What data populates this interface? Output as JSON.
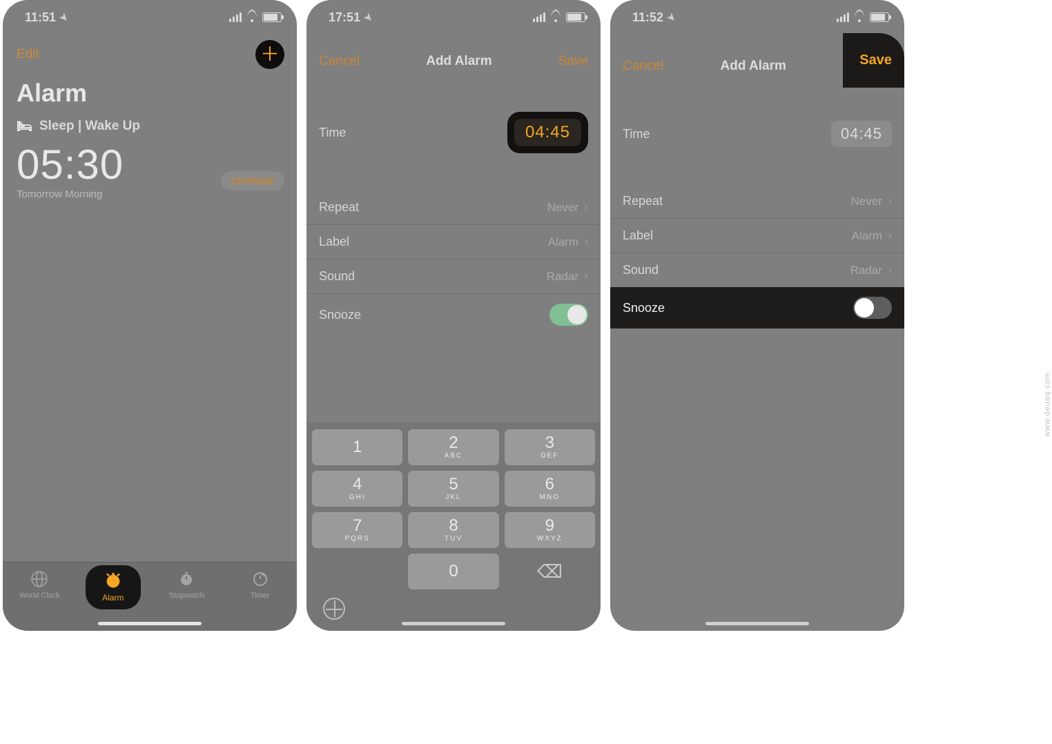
{
  "watermark": "www.deuaq.com",
  "screen1": {
    "status_time": "11:51",
    "edit": "Edit",
    "title": "Alarm",
    "sleep_label": "Sleep | Wake Up",
    "alarm_time": "05:30",
    "subtext": "Tomorrow Morning",
    "change": "CHANGE",
    "tabs": {
      "world_clock": "World Clock",
      "alarm": "Alarm",
      "stopwatch": "Stopwatch",
      "timer": "Timer"
    }
  },
  "screen2": {
    "status_time": "17:51",
    "cancel": "Cancel",
    "title": "Add Alarm",
    "save": "Save",
    "time_label": "Time",
    "time_value": "04:45",
    "repeat_label": "Repeat",
    "repeat_value": "Never",
    "label_label": "Label",
    "label_value": "Alarm",
    "sound_label": "Sound",
    "sound_value": "Radar",
    "snooze_label": "Snooze",
    "snooze_on": true,
    "keypad": {
      "1": {
        "num": "1",
        "letters": ""
      },
      "2": {
        "num": "2",
        "letters": "ABC"
      },
      "3": {
        "num": "3",
        "letters": "DEF"
      },
      "4": {
        "num": "4",
        "letters": "GHI"
      },
      "5": {
        "num": "5",
        "letters": "JKL"
      },
      "6": {
        "num": "6",
        "letters": "MNO"
      },
      "7": {
        "num": "7",
        "letters": "PQRS"
      },
      "8": {
        "num": "8",
        "letters": "TUV"
      },
      "9": {
        "num": "9",
        "letters": "WXYZ"
      },
      "0": {
        "num": "0",
        "letters": ""
      }
    }
  },
  "screen3": {
    "status_time": "11:52",
    "cancel": "Cancel",
    "title": "Add Alarm",
    "save": "Save",
    "time_label": "Time",
    "time_value": "04:45",
    "repeat_label": "Repeat",
    "repeat_value": "Never",
    "label_label": "Label",
    "label_value": "Alarm",
    "sound_label": "Sound",
    "sound_value": "Radar",
    "snooze_label": "Snooze",
    "snooze_on": false
  }
}
